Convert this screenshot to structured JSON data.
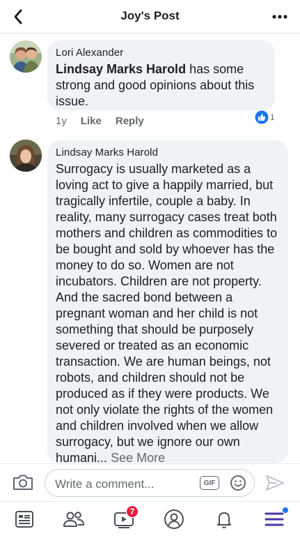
{
  "header": {
    "title": "Joy's Post"
  },
  "comments": [
    {
      "author": "Lori Alexander",
      "mention": "Lindsay Marks Harold",
      "text_after_mention": " has some strong and good opinions about this issue.",
      "time": "1y",
      "like_label": "Like",
      "reply_label": "Reply",
      "reaction_count": "1"
    },
    {
      "author": "Lindsay Marks Harold",
      "text": "Surrogacy is usually marketed as a loving act to give a happily married, but tragically infertile, couple a baby. In reality, many surrogacy cases treat both mothers and children as commodities to be bought and sold by whoever has the money to do so. Women are not incubators. Children are not property. And the sacred bond between a pregnant woman and her child is not something that should be purposely severed or treated as an economic transaction. We are human beings, not robots, and children should not be produced as if they were products. We not only violate the rights of the women and children involved when we allow surrogacy, but we ignore our own humani...",
      "see_more": "See More"
    }
  ],
  "composer": {
    "placeholder": "Write a comment...",
    "gif_label": "GIF"
  },
  "tabbar": {
    "video_badge": "7"
  },
  "colors": {
    "accent": "#1877f2",
    "badge": "#e41e3f",
    "bubble": "#f0f2f5"
  }
}
